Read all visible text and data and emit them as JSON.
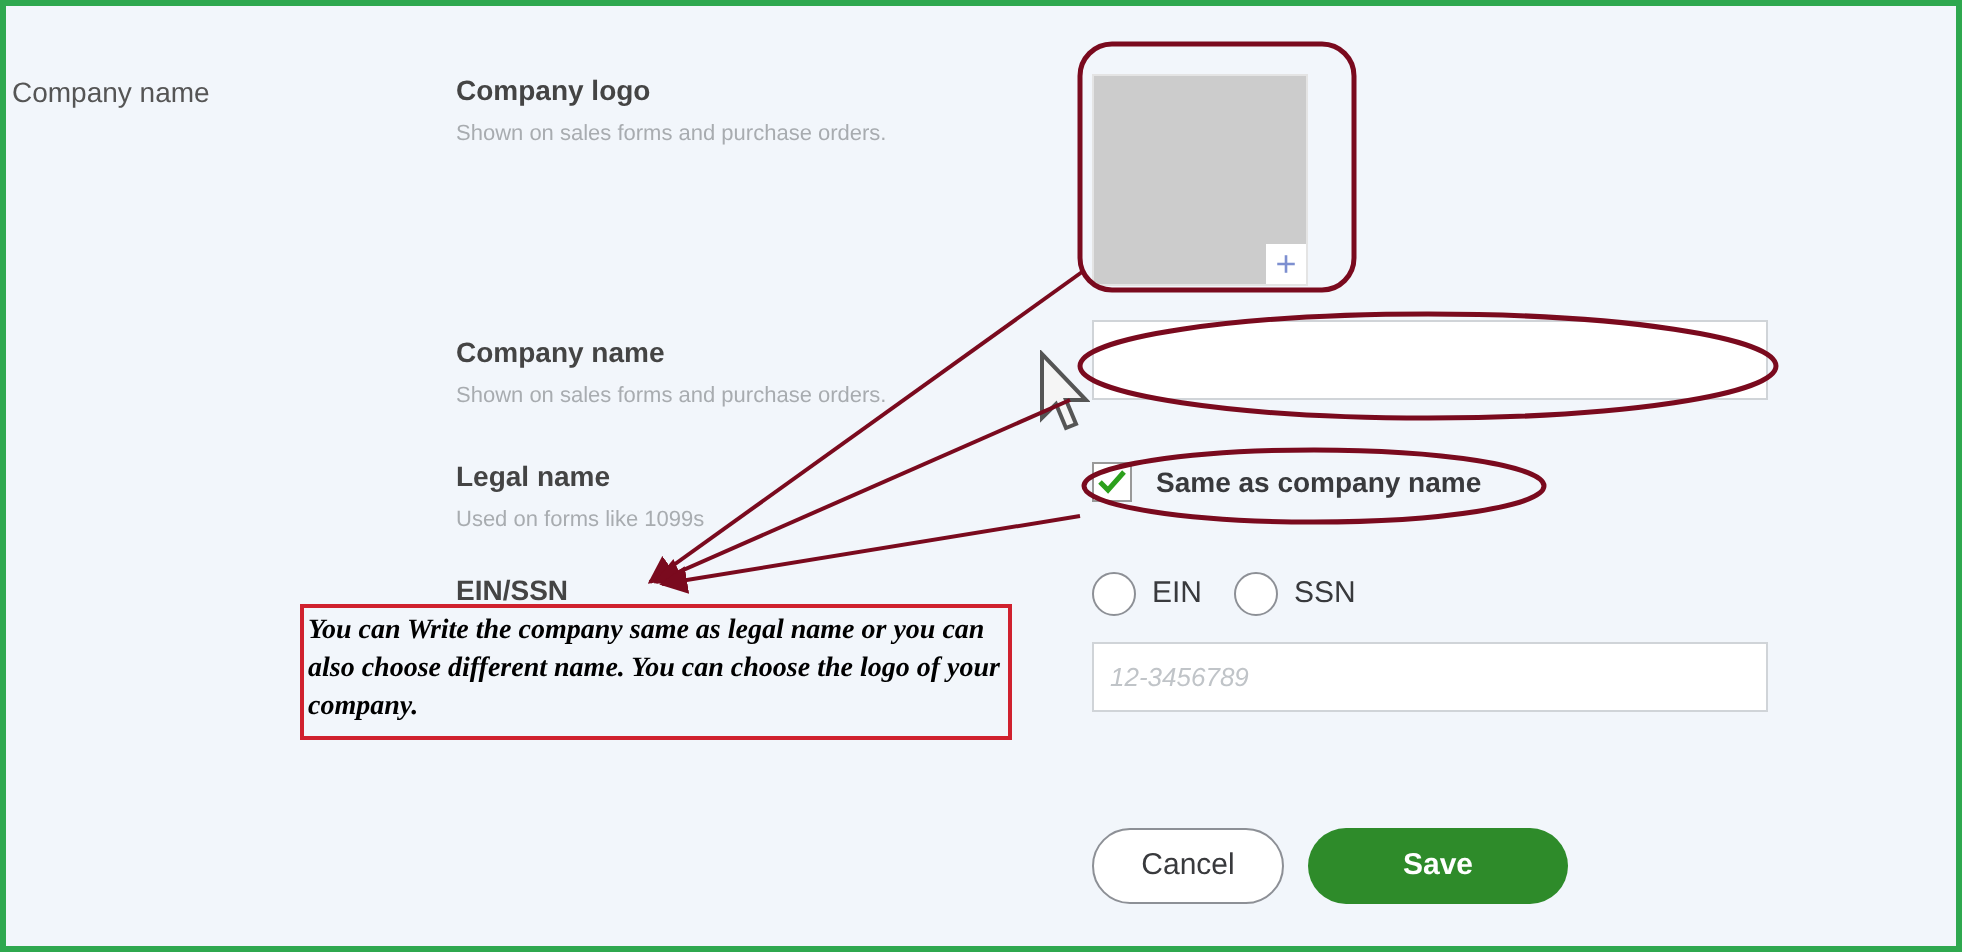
{
  "sidebar": {
    "label": "Company name"
  },
  "logo": {
    "title": "Company logo",
    "hint": "Shown on sales forms and purchase orders.",
    "add_symbol": "+"
  },
  "company_name": {
    "title": "Company name",
    "hint": "Shown on sales forms and purchase orders."
  },
  "legal_name": {
    "title": "Legal name",
    "hint": "Used on forms like 1099s",
    "same_as_company": {
      "label": "Same as company name",
      "checked": true
    }
  },
  "tax_id": {
    "title": "EIN/SSN",
    "options": [
      {
        "label": "EIN",
        "selected": false
      },
      {
        "label": "SSN",
        "selected": false
      }
    ],
    "placeholder": "12-3456789"
  },
  "buttons": [
    {
      "label": "Cancel",
      "kind": "secondary"
    },
    {
      "label": "Save",
      "kind": "primary"
    }
  ],
  "annotation": {
    "text": "You can Write the company same as legal name or you can also choose different name. You can choose the logo of your company."
  }
}
